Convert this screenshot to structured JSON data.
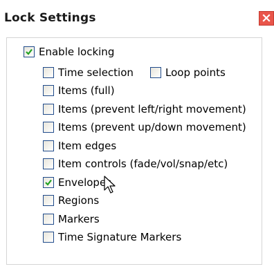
{
  "window": {
    "title": "Lock Settings",
    "close_icon": "close-icon",
    "accent": "#e9554a"
  },
  "options": {
    "enable_locking": {
      "label": "Enable locking",
      "checked": true
    },
    "time_selection": {
      "label": "Time selection",
      "checked": false
    },
    "loop_points": {
      "label": "Loop points",
      "checked": false
    },
    "items_full": {
      "label": "Items (full)",
      "checked": false
    },
    "items_prevent_lr": {
      "label": "Items (prevent left/right movement)",
      "checked": false
    },
    "items_prevent_ud": {
      "label": "Items (prevent up/down movement)",
      "checked": false
    },
    "item_edges": {
      "label": "Item edges",
      "checked": false
    },
    "item_controls": {
      "label": "Item controls (fade/vol/snap/etc)",
      "checked": false
    },
    "envelopes": {
      "label": "Envelopes",
      "checked": true
    },
    "regions": {
      "label": "Regions",
      "checked": false
    },
    "markers": {
      "label": "Markers",
      "checked": false
    },
    "time_signature_markers": {
      "label": "Time Signature Markers",
      "checked": false
    }
  },
  "colors": {
    "checkmark": "#21a121",
    "checkbox_border": "#1f4a8a"
  }
}
